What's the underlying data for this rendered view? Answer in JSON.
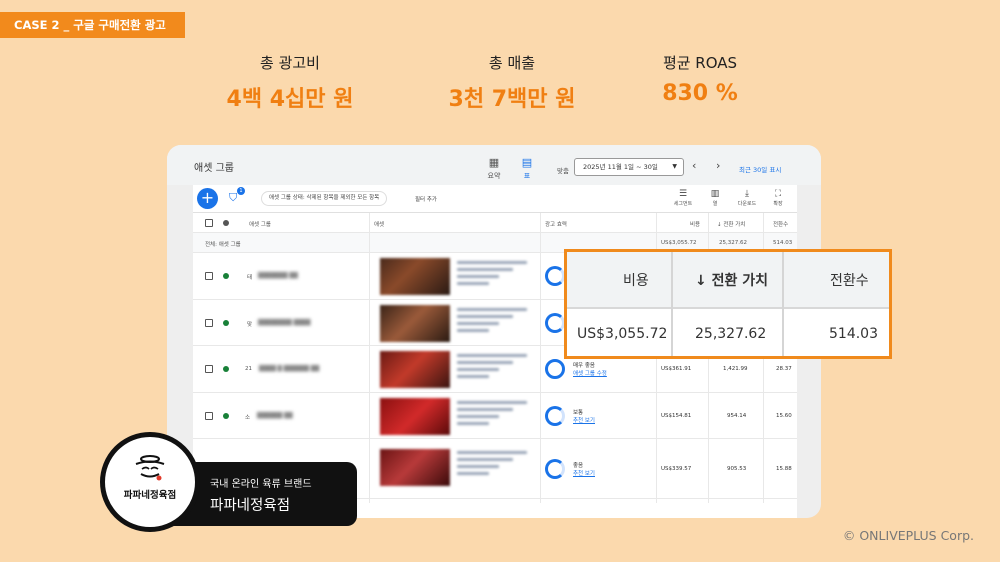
{
  "case_tag": "CASE 2 _ 구글 구매전환 광고",
  "stats": [
    {
      "label": "총 광고비",
      "value": "4백 4십만 원"
    },
    {
      "label": "총 매출",
      "value": "3천 7백만 원"
    },
    {
      "label": "평균 ROAS",
      "value": "830 %"
    }
  ],
  "panel": {
    "title": "애셋 그룹",
    "view_summary": "요약",
    "view_table": "표",
    "date_prefix": "맞춤",
    "date_range": "2025년 11월 1일 ~ 30일",
    "recent_link": "최근 30일 표시",
    "filter_chip": "애셋 그룹 상태: 삭제된 항목을 제외한 모든 항목",
    "filter_add": "필터 추가",
    "tools": [
      "세그먼트",
      "열",
      "다운로드",
      "확장"
    ],
    "columns": {
      "asset_group": "애셋 그룹",
      "assets": "애셋",
      "ad_strength": "광고 효력",
      "cost": "비용",
      "conv_value": "↓ 전환 가치",
      "conversions": "전환수"
    },
    "total_row": {
      "label": "전체: 애셋 그룹",
      "cost": "US$3,055.72",
      "conv_value": "25,327.62",
      "conversions": "514.03"
    },
    "rows": [
      {
        "name": "태",
        "strength": "",
        "strength_link": "",
        "cost": "",
        "conv_value": "",
        "conversions": ""
      },
      {
        "name": "맞",
        "strength": "",
        "strength_link": "",
        "cost": "",
        "conv_value": "",
        "conversions": ""
      },
      {
        "name": "21",
        "strength": "매우 좋음",
        "strength_link": "애셋 그룹 수정",
        "cost": "US$361.91",
        "conv_value": "1,421.99",
        "conversions": "28.37"
      },
      {
        "name": "소",
        "strength": "보통",
        "strength_link": "추천 보기",
        "cost": "US$154.81",
        "conv_value": "954.14",
        "conversions": "15.60"
      },
      {
        "name": "",
        "strength": "좋음",
        "strength_link": "추천 보기",
        "cost": "US$339.57",
        "conv_value": "905.53",
        "conversions": "15.88"
      }
    ]
  },
  "zoom": {
    "headers": [
      "비용",
      "↓ 전환 가치",
      "전환수"
    ],
    "values": [
      "US$3,055.72",
      "25,327.62",
      "514.03"
    ]
  },
  "brand": {
    "logo_text": "파파네정육점",
    "subtitle": "국내 온라인 육류 브랜드",
    "name": "파파네정육점"
  },
  "copyright": "© ONLIVEPLUS Corp.",
  "colors": {
    "accent": "#f07f12",
    "background": "#fbd9ad",
    "google_blue": "#1a73e8"
  }
}
